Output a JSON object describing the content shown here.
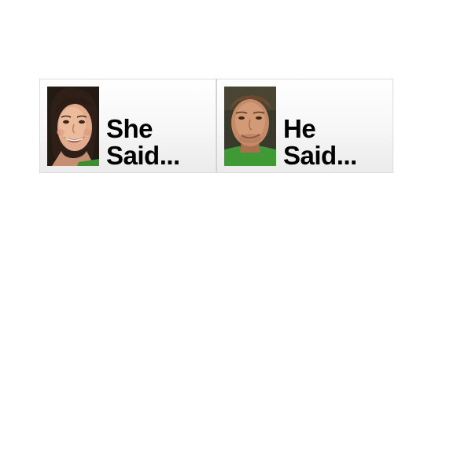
{
  "tabs": [
    {
      "line1": "She",
      "line2": "Said...",
      "avatar_icon": "woman-portrait-icon"
    },
    {
      "line1": "He",
      "line2": "Said...",
      "avatar_icon": "man-portrait-icon"
    }
  ]
}
